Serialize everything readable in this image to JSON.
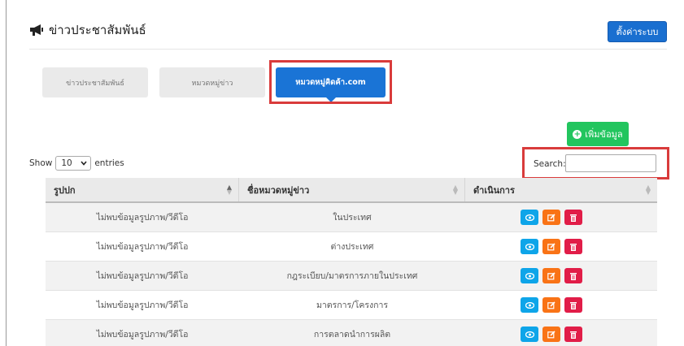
{
  "header": {
    "title": "ข่าวประชาสัมพันธ์",
    "title_icon": "megaphone-icon",
    "settings_label": "ตั้งค่าระบบ"
  },
  "tabs": [
    {
      "label": "ข่าวประชาสัมพันธ์",
      "active": false
    },
    {
      "label": "หมวดหมู่ข่าว",
      "active": false
    },
    {
      "label": "หมวดหมู่คิดค้า.com",
      "active": true
    }
  ],
  "toolbar": {
    "add_label": "เพิ่มข้อมูล",
    "add_icon": "plus-circle-icon",
    "show_label": "Show",
    "entries_value": "10",
    "entries_label": "entries",
    "search_label": "Search:",
    "search_value": ""
  },
  "table": {
    "headers": [
      "รูปปก",
      "ชื่อหมวดหมู่ข่าว",
      "ดำเนินการ"
    ],
    "rows": [
      {
        "cover": "ไม่พบข้อมูลรูปภาพ/วีดีโอ",
        "name": "ในประเทศ"
      },
      {
        "cover": "ไม่พบข้อมูลรูปภาพ/วีดีโอ",
        "name": "ต่างประเทศ"
      },
      {
        "cover": "ไม่พบข้อมูลรูปภาพ/วีดีโอ",
        "name": "กฎระเบียบ/มาตรการภายในประเทศ"
      },
      {
        "cover": "ไม่พบข้อมูลรูปภาพ/วีดีโอ",
        "name": "มาตรการ/โครงการ"
      },
      {
        "cover": "ไม่พบข้อมูลรูปภาพ/วีดีโอ",
        "name": "การตลาดนำการผลิต"
      }
    ],
    "action_icons": [
      "eye-icon",
      "edit-icon",
      "trash-icon"
    ]
  },
  "colors": {
    "primary": "#1a74d6",
    "success": "#22c55e",
    "info": "#0ea5e9",
    "warning": "#f97316",
    "danger": "#e11d48",
    "highlight": "#d93b3b"
  }
}
